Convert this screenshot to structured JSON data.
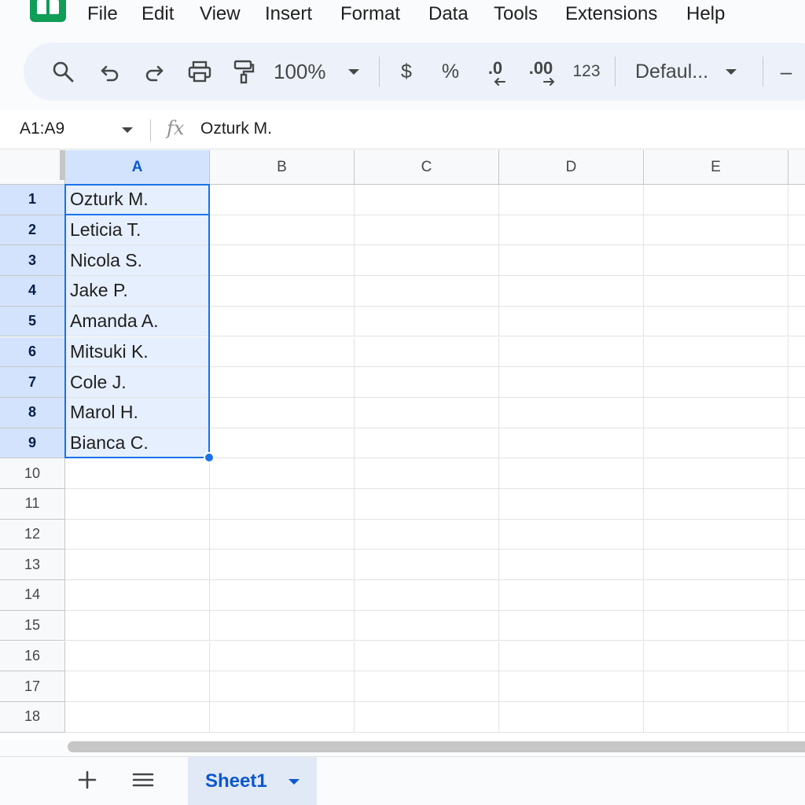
{
  "menu": {
    "items": [
      "File",
      "Edit",
      "View",
      "Insert",
      "Format",
      "Data",
      "Tools",
      "Extensions",
      "Help"
    ]
  },
  "toolbar": {
    "zoom": "100%",
    "currency": "$",
    "percent": "%",
    "decrease_decimal": ".0",
    "increase_decimal": ".00",
    "number_format": "123",
    "font": "Defaul...",
    "minus": "–"
  },
  "formula_bar": {
    "name_box": "A1:A9",
    "fx": "fx",
    "value": "Ozturk M."
  },
  "grid": {
    "columns": [
      "A",
      "B",
      "C",
      "D",
      "E"
    ],
    "selected_column": "A",
    "rows": [
      "1",
      "2",
      "3",
      "4",
      "5",
      "6",
      "7",
      "8",
      "9",
      "10",
      "11",
      "12",
      "13",
      "14",
      "15",
      "16",
      "17",
      "18"
    ],
    "selected_rows": 9,
    "column_a_values": [
      "Ozturk M.",
      "Leticia T.",
      "Nicola S.",
      "Jake P.",
      "Amanda A.",
      "Mitsuki K.",
      "Cole J.",
      "Marol H.",
      "Bianca C."
    ]
  },
  "sheets": {
    "tabs": [
      {
        "label": "Sheet1",
        "active": true
      }
    ]
  },
  "colors": {
    "accent": "#1a73e8",
    "brand": "#0f9d58",
    "selection_fill": "#e6effd",
    "header_selected": "#d3e3fd"
  }
}
